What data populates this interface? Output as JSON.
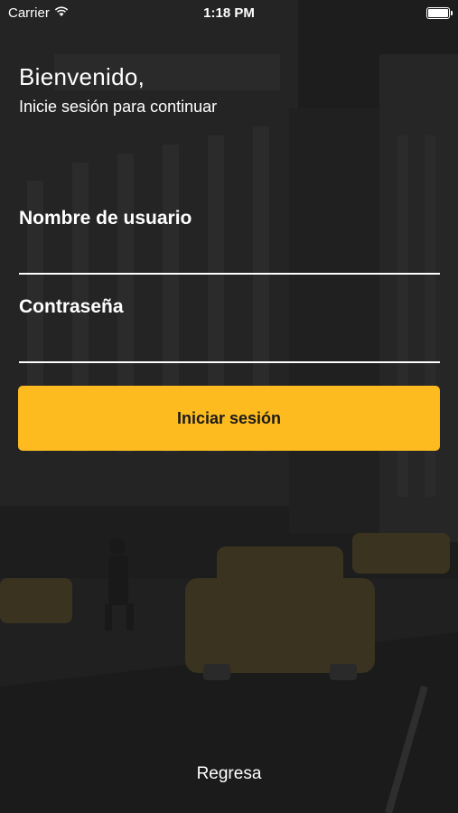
{
  "status_bar": {
    "carrier": "Carrier",
    "time": "1:18 PM"
  },
  "header": {
    "title": "Bienvenido,",
    "subtitle": "Inicie sesión para continuar"
  },
  "form": {
    "username_label": "Nombre de usuario",
    "username_value": "",
    "password_label": "Contraseña",
    "password_value": "",
    "submit_label": "Iniciar sesión"
  },
  "footer": {
    "back_label": "Regresa"
  },
  "colors": {
    "accent": "#fdbb1f",
    "background": "#1c1c1d",
    "text": "#ffffff"
  }
}
